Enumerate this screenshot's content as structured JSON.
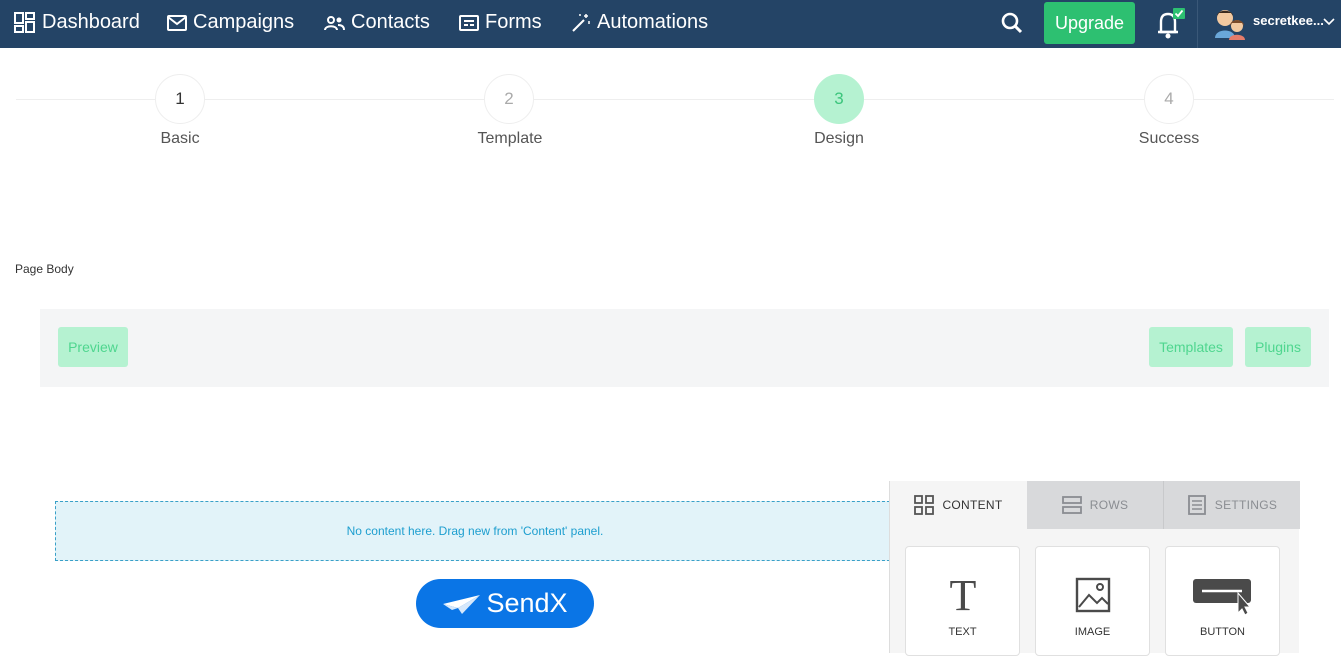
{
  "nav": {
    "items": [
      {
        "label": "Dashboard",
        "icon": "dashboard-icon"
      },
      {
        "label": "Campaigns",
        "icon": "envelope-icon"
      },
      {
        "label": "Contacts",
        "icon": "people-icon"
      },
      {
        "label": "Forms",
        "icon": "form-icon"
      },
      {
        "label": "Automations",
        "icon": "magic-wand-icon"
      }
    ],
    "upgrade_label": "Upgrade",
    "user_name": "secretkee...",
    "colors": {
      "background": "#244466",
      "upgrade": "#2dc071",
      "notification_badge": "#2dc071"
    }
  },
  "stepper": {
    "steps": [
      {
        "number": "1",
        "label": "Basic",
        "state": "done"
      },
      {
        "number": "2",
        "label": "Template",
        "state": "pending"
      },
      {
        "number": "3",
        "label": "Design",
        "state": "active"
      },
      {
        "number": "4",
        "label": "Success",
        "state": "pending"
      }
    ],
    "active_color": "#b5f2d1"
  },
  "page_body_label": "Page Body",
  "toolbar": {
    "preview_label": "Preview",
    "templates_label": "Templates",
    "plugins_label": "Plugins"
  },
  "canvas": {
    "empty_message": "No content here. Drag new from 'Content' panel.",
    "logo_text": "SendX"
  },
  "panel": {
    "tabs": [
      {
        "label": "CONTENT",
        "icon": "grid-icon",
        "active": true
      },
      {
        "label": "ROWS",
        "icon": "rows-icon",
        "active": false
      },
      {
        "label": "SETTINGS",
        "icon": "settings-doc-icon",
        "active": false
      }
    ],
    "blocks": [
      {
        "label": "TEXT",
        "icon": "text-icon"
      },
      {
        "label": "IMAGE",
        "icon": "image-icon"
      },
      {
        "label": "BUTTON",
        "icon": "button-icon"
      }
    ]
  }
}
